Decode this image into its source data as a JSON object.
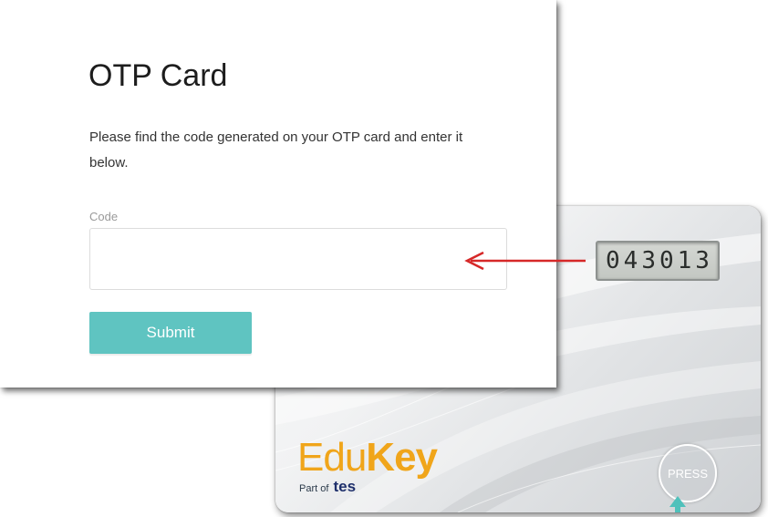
{
  "form": {
    "title": "OTP Card",
    "description": "Please find the code generated on your OTP card and enter it below.",
    "code_label": "Code",
    "code_value": "",
    "code_placeholder": "",
    "submit_label": "Submit"
  },
  "otp_card": {
    "display_code": "043013",
    "brand_primary": "Edu",
    "brand_secondary": "Key",
    "brand_tagline_prefix": "Part of",
    "brand_tagline_name": "tes",
    "press_label": "PRESS"
  },
  "icons": {
    "arrow": "arrow-left-icon",
    "pointer": "pointer-icon"
  },
  "colors": {
    "submit_button": "#5fc4c1",
    "arrow": "#d62828",
    "brand_orange": "#f0a51a",
    "tes_navy": "#1e2f6b",
    "press_pointer": "#4fc1bb"
  }
}
